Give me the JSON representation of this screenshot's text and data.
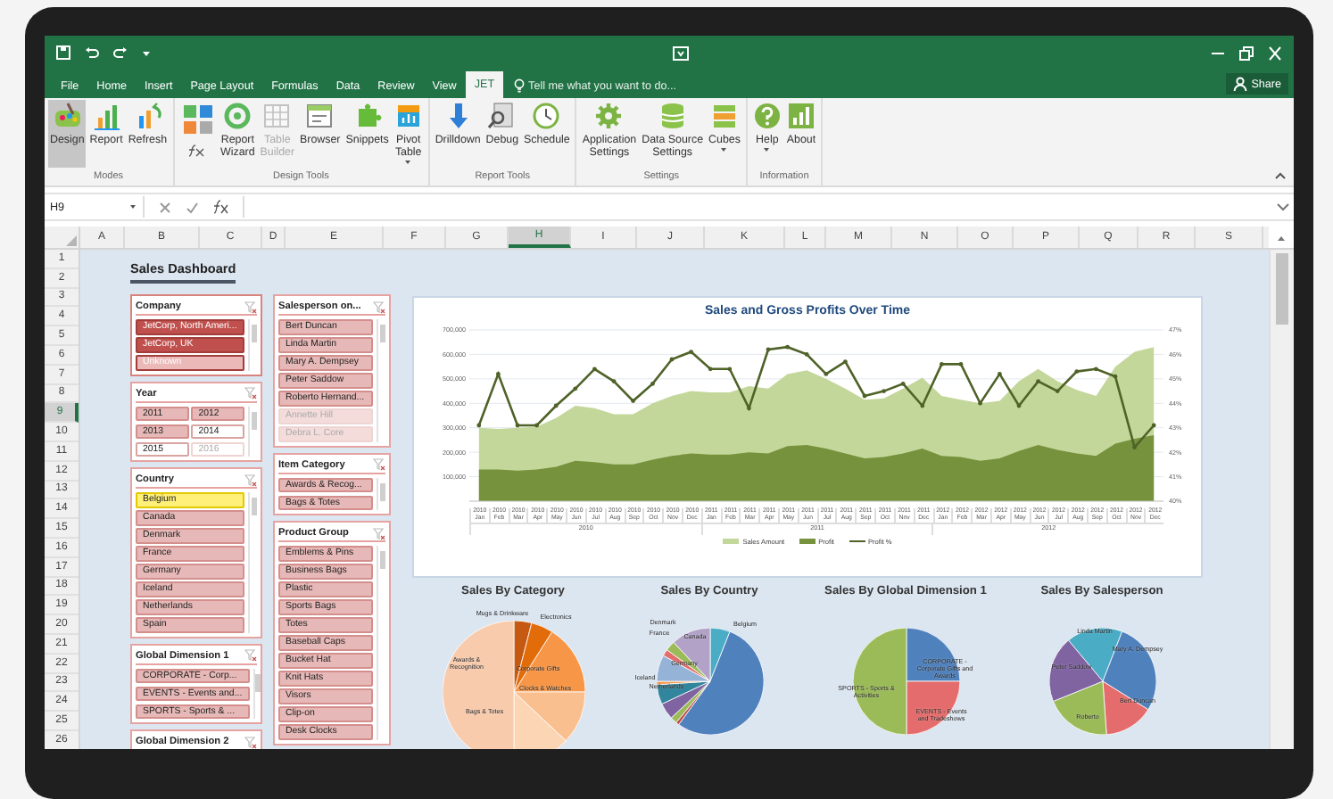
{
  "tabs": [
    {
      "label": "File",
      "selected": false
    },
    {
      "label": "Home",
      "selected": false
    },
    {
      "label": "Insert",
      "selected": false
    },
    {
      "label": "Page Layout",
      "selected": false
    },
    {
      "label": "Formulas",
      "selected": false
    },
    {
      "label": "Data",
      "selected": false
    },
    {
      "label": "Review",
      "selected": false
    },
    {
      "label": "View",
      "selected": false
    },
    {
      "label": "JET",
      "selected": true
    }
  ],
  "tell_me": {
    "placeholder": "Tell me what you want to do..."
  },
  "share_button": "Share",
  "ribbon": {
    "groups": [
      {
        "label": "Modes",
        "buttons": [
          {
            "kind": "large",
            "label": "Design",
            "selected": true,
            "disabled": false,
            "dropdown": false
          },
          {
            "kind": "large",
            "label": "Report",
            "selected": false,
            "disabled": false,
            "dropdown": false
          },
          {
            "kind": "large",
            "label": "Refresh",
            "selected": false,
            "disabled": false,
            "dropdown": false
          }
        ]
      },
      {
        "label": "Design Tools",
        "buttons": [
          {
            "kind": "small_icons",
            "selected": false,
            "disabled": false
          },
          {
            "kind": "large",
            "label": "Report\nWizard",
            "selected": false,
            "disabled": false,
            "dropdown": false
          },
          {
            "kind": "large",
            "label": "Table\nBuilder",
            "selected": false,
            "disabled": true,
            "dropdown": false
          },
          {
            "kind": "large",
            "label": "Browser",
            "selected": false,
            "disabled": false,
            "dropdown": false
          },
          {
            "kind": "large",
            "label": "Snippets",
            "selected": false,
            "disabled": false,
            "dropdown": false
          },
          {
            "kind": "large",
            "label": "Pivot\nTable",
            "selected": false,
            "disabled": false,
            "dropdown": true
          }
        ]
      },
      {
        "label": "Report Tools",
        "buttons": [
          {
            "kind": "large",
            "label": "Drilldown",
            "selected": false,
            "disabled": false,
            "dropdown": false
          },
          {
            "kind": "large",
            "label": "Debug",
            "selected": false,
            "disabled": false,
            "dropdown": false
          },
          {
            "kind": "large",
            "label": "Schedule",
            "selected": false,
            "disabled": false,
            "dropdown": false
          }
        ]
      },
      {
        "label": "Settings",
        "buttons": [
          {
            "kind": "large",
            "label": "Application\nSettings",
            "selected": false,
            "disabled": false,
            "dropdown": false
          },
          {
            "kind": "large",
            "label": "Data Source\nSettings",
            "selected": false,
            "disabled": false,
            "dropdown": false
          },
          {
            "kind": "large",
            "label": "Cubes",
            "selected": false,
            "disabled": false,
            "dropdown": true
          }
        ]
      },
      {
        "label": "Information",
        "buttons": [
          {
            "kind": "large",
            "label": "Help",
            "selected": false,
            "disabled": false,
            "dropdown": true
          },
          {
            "kind": "large",
            "label": "About",
            "selected": false,
            "disabled": false,
            "dropdown": false
          }
        ]
      }
    ]
  },
  "formula_bar": {
    "name_box": "H9"
  },
  "columns": [
    {
      "label": "A",
      "selected": false
    },
    {
      "label": "B",
      "selected": false
    },
    {
      "label": "C",
      "selected": false
    },
    {
      "label": "D",
      "selected": false
    },
    {
      "label": "E",
      "selected": false
    },
    {
      "label": "F",
      "selected": false
    },
    {
      "label": "G",
      "selected": false
    },
    {
      "label": "H",
      "selected": true
    },
    {
      "label": "I",
      "selected": false
    },
    {
      "label": "J",
      "selected": false
    },
    {
      "label": "K",
      "selected": false
    },
    {
      "label": "L",
      "selected": false
    },
    {
      "label": "M",
      "selected": false
    },
    {
      "label": "N",
      "selected": false
    },
    {
      "label": "O",
      "selected": false
    },
    {
      "label": "P",
      "selected": false
    },
    {
      "label": "Q",
      "selected": false
    },
    {
      "label": "R",
      "selected": false
    },
    {
      "label": "S",
      "selected": false
    }
  ],
  "rows": [
    {
      "label": "1",
      "selected": false
    },
    {
      "label": "2",
      "selected": false
    },
    {
      "label": "3",
      "selected": false
    },
    {
      "label": "4",
      "selected": false
    },
    {
      "label": "5",
      "selected": false
    },
    {
      "label": "6",
      "selected": false
    },
    {
      "label": "7",
      "selected": false
    },
    {
      "label": "8",
      "selected": false
    },
    {
      "label": "9",
      "selected": true
    },
    {
      "label": "10",
      "selected": false
    },
    {
      "label": "11",
      "selected": false
    },
    {
      "label": "12",
      "selected": false
    },
    {
      "label": "13",
      "selected": false
    },
    {
      "label": "14",
      "selected": false
    },
    {
      "label": "15",
      "selected": false
    },
    {
      "label": "16",
      "selected": false
    },
    {
      "label": "17",
      "selected": false
    },
    {
      "label": "18",
      "selected": false
    },
    {
      "label": "19",
      "selected": false
    },
    {
      "label": "20",
      "selected": false
    },
    {
      "label": "21",
      "selected": false
    },
    {
      "label": "22",
      "selected": false
    },
    {
      "label": "23",
      "selected": false
    },
    {
      "label": "24",
      "selected": false
    },
    {
      "label": "25",
      "selected": false
    },
    {
      "label": "26",
      "selected": false
    }
  ],
  "dashboard": {
    "title": "Sales Dashboard",
    "slicers_left": [
      {
        "title": "Company",
        "kind": "list",
        "focused": true,
        "items": [
          {
            "label": "JetCorp, North Ameri...",
            "selected": true,
            "available": true,
            "hovered": false
          },
          {
            "label": "JetCorp, UK",
            "selected": true,
            "available": true,
            "hovered": false
          },
          {
            "label": "Unknown",
            "selected": true,
            "available": false,
            "hovered": false
          }
        ]
      },
      {
        "title": "Year",
        "kind": "grid",
        "focused": false,
        "items": [
          {
            "label": "2011",
            "selected": true,
            "available": true,
            "hovered": false
          },
          {
            "label": "2012",
            "selected": true,
            "available": true,
            "hovered": false
          },
          {
            "label": "2013",
            "selected": true,
            "available": true,
            "hovered": false
          },
          {
            "label": "2014",
            "selected": false,
            "available": true,
            "hovered": false
          },
          {
            "label": "2015",
            "selected": false,
            "available": true,
            "hovered": false
          },
          {
            "label": "2016",
            "selected": false,
            "available": false,
            "hovered": false
          }
        ]
      },
      {
        "title": "Country",
        "kind": "list",
        "focused": false,
        "items": [
          {
            "label": "Belgium",
            "selected": true,
            "available": true,
            "hovered": true
          },
          {
            "label": "Canada",
            "selected": true,
            "available": true,
            "hovered": false
          },
          {
            "label": "Denmark",
            "selected": true,
            "available": true,
            "hovered": false
          },
          {
            "label": "France",
            "selected": true,
            "available": true,
            "hovered": false
          },
          {
            "label": "Germany",
            "selected": true,
            "available": true,
            "hovered": false
          },
          {
            "label": "Iceland",
            "selected": true,
            "available": true,
            "hovered": false
          },
          {
            "label": "Netherlands",
            "selected": true,
            "available": true,
            "hovered": false
          },
          {
            "label": "Spain",
            "selected": true,
            "available": true,
            "hovered": false
          }
        ]
      },
      {
        "title": "Global Dimension 1",
        "kind": "list",
        "focused": false,
        "items": [
          {
            "label": "CORPORATE - Corp...",
            "selected": true,
            "available": true,
            "hovered": false
          },
          {
            "label": "EVENTS - Events and...",
            "selected": true,
            "available": true,
            "hovered": false
          },
          {
            "label": "SPORTS - Sports & ...",
            "selected": true,
            "available": true,
            "hovered": false
          }
        ]
      },
      {
        "title": "Global Dimension 2",
        "kind": "list",
        "focused": false
      }
    ],
    "slicers_right": [
      {
        "title": "Salesperson on...",
        "kind": "list",
        "focused": false,
        "items": [
          {
            "label": "Bert Duncan",
            "selected": true,
            "available": true,
            "hovered": false
          },
          {
            "label": "Linda Martin",
            "selected": true,
            "available": true,
            "hovered": false
          },
          {
            "label": "Mary A. Dempsey",
            "selected": true,
            "available": true,
            "hovered": false
          },
          {
            "label": "Peter Saddow",
            "selected": true,
            "available": true,
            "hovered": false
          },
          {
            "label": "Roberto Hernand...",
            "selected": true,
            "available": true,
            "hovered": false
          },
          {
            "label": "Annette Hill",
            "selected": true,
            "available": false,
            "hovered": false
          },
          {
            "label": "Debra L. Core",
            "selected": true,
            "available": false,
            "hovered": false
          }
        ]
      },
      {
        "title": "Item Category",
        "kind": "list",
        "focused": false,
        "items": [
          {
            "label": "Awards & Recog...",
            "selected": true,
            "available": true,
            "hovered": false
          },
          {
            "label": "Bags & Totes",
            "selected": true,
            "available": true,
            "hovered": false
          }
        ]
      },
      {
        "title": "Product Group",
        "kind": "list",
        "focused": false,
        "items": [
          {
            "label": "Emblems & Pins",
            "selected": true,
            "available": true,
            "hovered": false
          },
          {
            "label": "Business Bags",
            "selected": true,
            "available": true,
            "hovered": false
          },
          {
            "label": "Plastic",
            "selected": true,
            "available": true,
            "hovered": false
          },
          {
            "label": "Sports Bags",
            "selected": true,
            "available": true,
            "hovered": false
          },
          {
            "label": "Totes",
            "selected": true,
            "available": true,
            "hovered": false
          },
          {
            "label": "Baseball Caps",
            "selected": true,
            "available": true,
            "hovered": false
          },
          {
            "label": "Bucket Hat",
            "selected": true,
            "available": true,
            "hovered": false
          },
          {
            "label": "Knit Hats",
            "selected": true,
            "available": true,
            "hovered": false
          },
          {
            "label": "Visors",
            "selected": true,
            "available": true,
            "hovered": false
          },
          {
            "label": "Clip-on",
            "selected": true,
            "available": true,
            "hovered": false
          },
          {
            "label": "Desk Clocks",
            "selected": true,
            "available": true,
            "hovered": false
          }
        ]
      }
    ],
    "sales_chart": {
      "chart_data": {
        "type": "area",
        "title": "Sales and Gross Profits Over Time",
        "categories": [
          "2010 Jan",
          "2010 Feb",
          "2010 Mar",
          "2010 Apr",
          "2010 May",
          "2010 Jun",
          "2010 Jul",
          "2010 Aug",
          "2010 Sep",
          "2010 Oct",
          "2010 Nov",
          "2010 Dec",
          "2011 Jan",
          "2011 Feb",
          "2011 Mar",
          "2011 Apr",
          "2011 May",
          "2011 Jun",
          "2011 Jul",
          "2011 Aug",
          "2011 Sep",
          "2011 Oct",
          "2011 Nov",
          "2011 Dec",
          "2012 Jan",
          "2012 Feb",
          "2012 Mar",
          "2012 Apr",
          "2012 May",
          "2012 Jun",
          "2012 Jul",
          "2012 Aug",
          "2012 Sep",
          "2012 Oct",
          "2012 Nov",
          "2012 Dec"
        ],
        "annotations": [
          {
            "text": "2010"
          },
          {
            "text": "2011"
          },
          {
            "text": "2012"
          }
        ],
        "series": [
          {
            "name": "Sales Amount",
            "color": "#c4d79b",
            "type": "area",
            "values": [
              300000,
              295000,
              300000,
              305000,
              340000,
              390000,
              380000,
              355000,
              355000,
              400000,
              430000,
              450000,
              445000,
              445000,
              470000,
              460000,
              520000,
              535000,
              500000,
              460000,
              415000,
              420000,
              460000,
              505000,
              430000,
              415000,
              400000,
              410000,
              490000,
              540000,
              490000,
              455000,
              430000,
              550000,
              610000,
              630000
            ]
          },
          {
            "name": "Profit",
            "color": "#76923c",
            "type": "area",
            "values": [
              130000,
              130000,
              125000,
              130000,
              140000,
              165000,
              160000,
              150000,
              150000,
              170000,
              185000,
              195000,
              190000,
              190000,
              200000,
              195000,
              225000,
              230000,
              215000,
              195000,
              175000,
              180000,
              195000,
              215000,
              185000,
              180000,
              165000,
              175000,
              205000,
              230000,
              210000,
              195000,
              185000,
              235000,
              255000,
              270000
            ]
          },
          {
            "name": "Profit %",
            "color": "#4f6228",
            "type": "line",
            "axis": "y2",
            "values": [
              43.1,
              45.2,
              43.1,
              43.1,
              43.9,
              44.6,
              45.4,
              44.9,
              44.1,
              44.8,
              45.8,
              46.1,
              45.4,
              45.4,
              43.8,
              46.2,
              46.3,
              46.0,
              45.2,
              45.7,
              44.3,
              44.5,
              44.8,
              43.9,
              45.6,
              45.6,
              44.0,
              45.2,
              43.9,
              44.9,
              44.5,
              45.3,
              45.4,
              45.1,
              42.2,
              43.1
            ]
          }
        ],
        "ylim": [
          0,
          700000
        ],
        "y2lim": [
          40,
          47
        ],
        "y2ticks": [
          {
            "value": 40,
            "label": "40%"
          },
          {
            "value": 41,
            "label": "41%"
          },
          {
            "value": 42,
            "label": "42%"
          },
          {
            "value": 43,
            "label": "43%"
          },
          {
            "value": 44,
            "label": "44%"
          },
          {
            "value": 45,
            "label": "45%"
          },
          {
            "value": 46,
            "label": "46%"
          },
          {
            "value": 47,
            "label": "47%"
          }
        ],
        "grid": true,
        "legend": "bottom",
        "yticks": [
          {
            "value": 100000,
            "label": "100,000"
          },
          {
            "value": 200000,
            "label": "200,000"
          },
          {
            "value": 300000,
            "label": "300,000"
          },
          {
            "value": 400000,
            "label": "400,000"
          },
          {
            "value": 500000,
            "label": "500,000"
          },
          {
            "value": 600000,
            "label": "600,000"
          },
          {
            "value": 700000,
            "label": "700,000"
          }
        ]
      }
    },
    "pies": [
      {
        "title": "Sales By Category",
        "labels": [
          "Mugs & Drinkware",
          "Electronics",
          "Awards & Recognition",
          "Corporate Gifts",
          "Clocks & Watches",
          "Bags & Totes"
        ]
      },
      {
        "title": "Sales By Country",
        "labels": [
          "Denmark",
          "France",
          "Canada",
          "Belgium",
          "Germany",
          "Iceland",
          "Netherlands"
        ]
      },
      {
        "title": "Sales By Global Dimension 1",
        "labels": [
          "CORPORATE - Corporate Gifts and Awards",
          "SPORTS - Sports & Activities",
          "EVENTS - Events and Tradeshows"
        ]
      },
      {
        "title": "Sales By Salesperson",
        "labels": [
          "Linda Martin",
          "Mary A. Dempsey",
          "Peter Saddow",
          "Bert Duncan",
          "Roberto"
        ]
      }
    ]
  }
}
